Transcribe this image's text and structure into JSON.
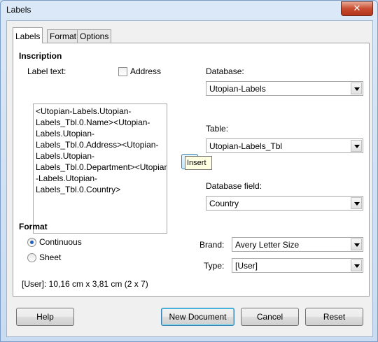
{
  "window": {
    "title": "Labels",
    "close_label": "✕"
  },
  "tabs": [
    "Labels",
    "Format",
    "Options"
  ],
  "inscription": {
    "heading": "Inscription",
    "label_text_label": "Label text:",
    "address_label": "Address",
    "address_checked": false,
    "label_text_value": "<Utopian-Labels.Utopian-\nLabels_Tbl.0.Name><Utopian-\nLabels.Utopian-\nLabels_Tbl.0.Address><Utopian-\nLabels.Utopian-\nLabels_Tbl.0.Department><Utopian\n-Labels.Utopian-\nLabels_Tbl.0.Country>"
  },
  "insert": {
    "tooltip": "Insert",
    "icon": "left-arrow-icon"
  },
  "database": {
    "label": "Database:",
    "value": "Utopian-Labels"
  },
  "table": {
    "label": "Table:",
    "value": "Utopian-Labels_Tbl"
  },
  "database_field": {
    "label": "Database field:",
    "value": "Country"
  },
  "format": {
    "heading": "Format",
    "continuous_label": "Continuous",
    "sheet_label": "Sheet",
    "selected": "Continuous",
    "brand_label": "Brand:",
    "brand_value": "Avery Letter Size",
    "type_label": "Type:",
    "type_value": "[User]",
    "size_info": "[User]: 10,16 cm x 3,81 cm (2 x 7)"
  },
  "buttons": {
    "help": "Help",
    "new_document": "New Document",
    "cancel": "Cancel",
    "reset": "Reset"
  }
}
